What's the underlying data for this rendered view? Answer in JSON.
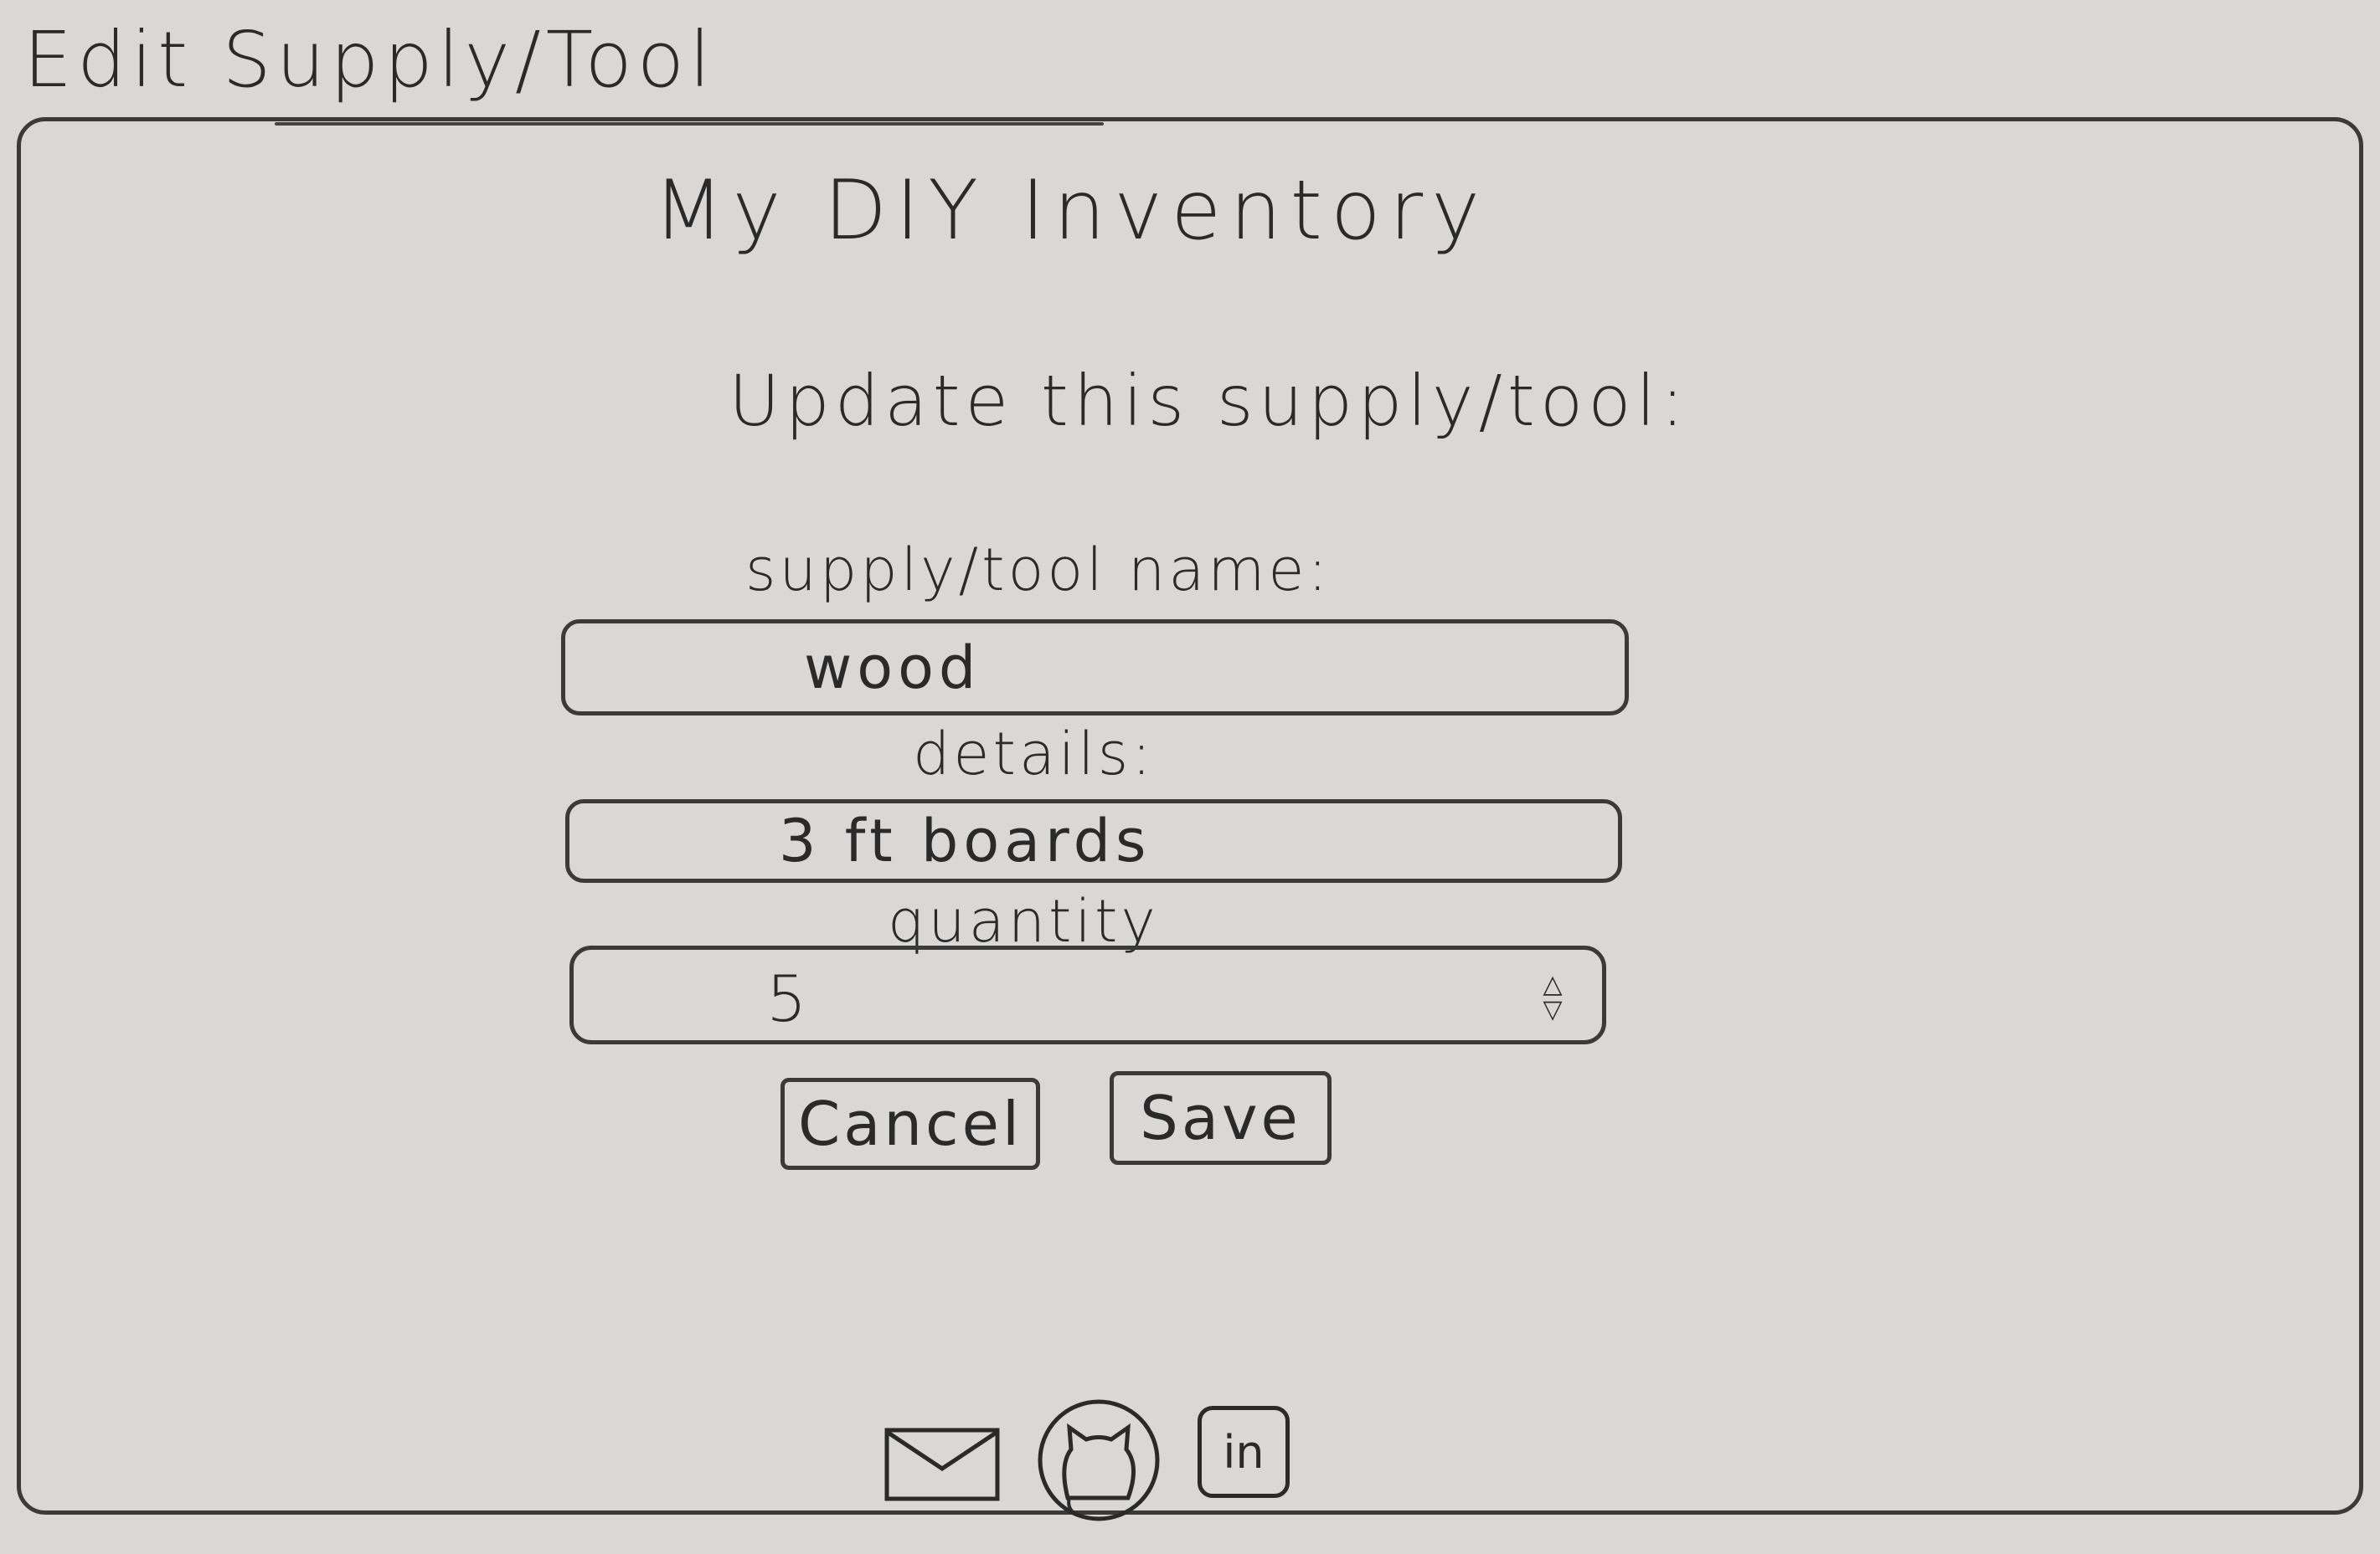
{
  "page": {
    "sheet_title": "Edit Supply/Tool",
    "app_title": "My DIY Inventory",
    "prompt": "Update this supply/tool:"
  },
  "form": {
    "name_label": "supply/tool name:",
    "name_value": "wood",
    "details_label": "details:",
    "details_value": "3 ft boards",
    "quantity_label": "quantity",
    "quantity_value": "5",
    "cancel_label": "Cancel",
    "save_label": "Save"
  },
  "footer": {
    "icons": [
      "mail-icon",
      "github-icon",
      "linkedin-icon"
    ],
    "linkedin_text": "in"
  }
}
